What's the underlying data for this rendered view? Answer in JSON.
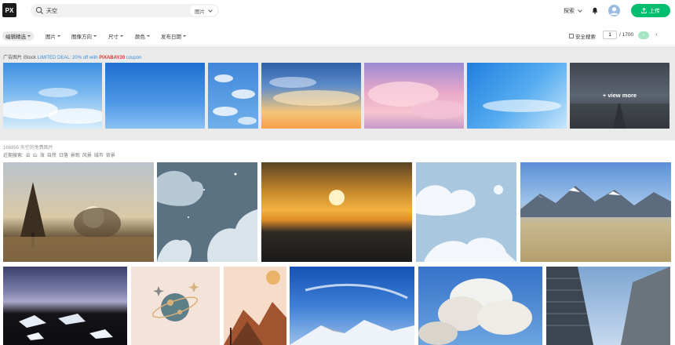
{
  "header": {
    "logo": "PX",
    "search_value": "天空",
    "search_type": "图片",
    "explore": "探索",
    "upload": "上传"
  },
  "filters": {
    "items": [
      "编辑精选",
      "图片",
      "图像方向",
      "尺寸",
      "颜色",
      "发布日期"
    ],
    "safe_search": "安全搜索",
    "page": "1",
    "total_pages": "/ 1700",
    "next": "›"
  },
  "sponsored": {
    "prefix": "广告图片 iStock ",
    "deal": "LIMITED DEAL: 20% off with ",
    "code": "PIXABAY20",
    "suffix": " coupon",
    "view_more": "+ view more"
  },
  "results": {
    "count": "166955 天空的免费图片",
    "related_label": "近期搜索:",
    "related": [
      "云",
      "山",
      "海",
      "自然",
      "日落",
      "景观",
      "风景",
      "城市",
      "背景"
    ]
  },
  "colors": {
    "accent": "#02be6e",
    "coupon_red": "#e0322e",
    "deal_blue": "#3b8ed8"
  }
}
